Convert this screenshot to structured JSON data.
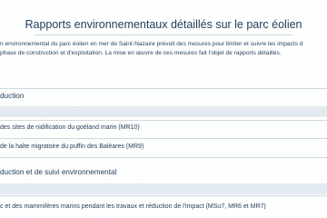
{
  "page": {
    "title": "Rapports environnementaux détaillés sur le parc éolien",
    "intro_lines": [
      "n environnemental du parc éolien en mer de Saint-Nazaire prévoit des mesures pour limiter et suivre les impacts d",
      "phase de construction et d'exploitation. La mise en œuvre de ces mesures fait l'objet de rapports détaillés."
    ]
  },
  "sections": [
    {
      "title": "duction",
      "links": [
        "des sites de nidification du goéland marin (MR10)",
        "de la halte migratoire du puffin des Baléares (MR9)"
      ]
    },
    {
      "title": "duction et de suivi environnemental",
      "links": [
        "c et des mammifères marins pendant les travaux et réduction de l'impact (MSu7, MR6 et MR7)"
      ]
    }
  ],
  "colors": {
    "text": "#1f3b56",
    "divider": "#cfd9e1",
    "background": "#ffffff"
  }
}
